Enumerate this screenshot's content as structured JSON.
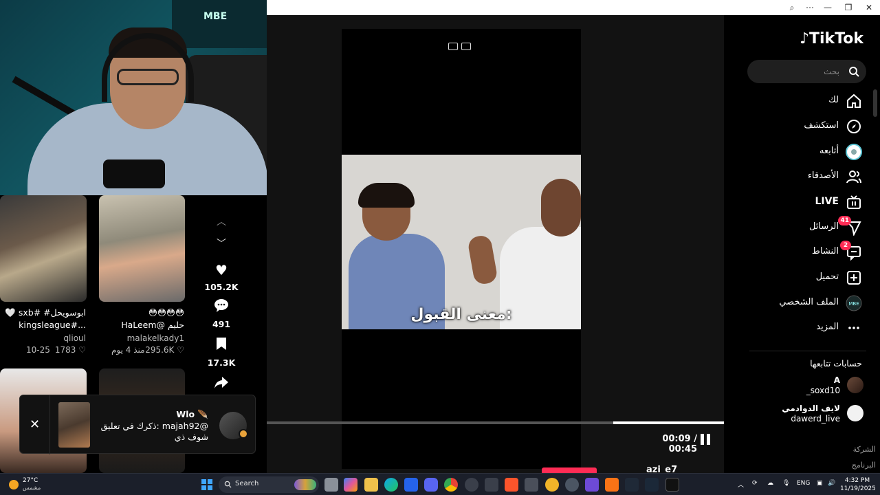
{
  "tiktok": {
    "brand": "TikTok",
    "search_placeholder": "بحث",
    "nav": [
      {
        "label": "لك",
        "icon": "home-icon"
      },
      {
        "label": "استكشف",
        "icon": "compass-icon"
      },
      {
        "label": "أتابعه",
        "icon": "following-avatar-icon"
      },
      {
        "label": "الأصدقاء",
        "icon": "friends-icon"
      },
      {
        "label": "LIVE",
        "icon": "live-tv-icon"
      },
      {
        "label": "الرسائل",
        "icon": "messages-icon",
        "badge": "41"
      },
      {
        "label": "النشاط",
        "icon": "activity-icon",
        "badge": "2"
      },
      {
        "label": "تحميل",
        "icon": "upload-plus-icon"
      },
      {
        "label": "الملف الشخصي",
        "icon": "profile-avatar-icon"
      },
      {
        "label": "المزيد",
        "icon": "more-dots-icon"
      }
    ],
    "following_title": "حسابات تتابعها",
    "following": [
      {
        "name": "A",
        "handle": "_soxd10"
      },
      {
        "name": "لايف الدوادمي",
        "handle": "dawerd_live"
      }
    ],
    "footer": [
      "الشركة",
      "البرنامج"
    ],
    "accent": "#fe2c55"
  },
  "video": {
    "caption": "معنى القبول:",
    "current_time": "00:09",
    "duration": "00:45",
    "time_display": "00:09 / 00:45",
    "progress": 0.2,
    "peek_author": "azi_e7"
  },
  "actions": {
    "likes": "105.2K",
    "comments": "491",
    "saves": "17.3K"
  },
  "grid": [
    {
      "title1": "🤍 sxb# #ابوسويحل",
      "title2": "kingsleague#...",
      "author": "qlioul",
      "date": "10-25",
      "likes": "1783 ♡"
    },
    {
      "title1": "😳😳😳😳",
      "title2": "HaLeem@ حليم",
      "author": "malakelkady1",
      "date": "منذ 4 يوم",
      "likes": "295.6K ♡"
    }
  ],
  "notification": {
    "user": "Wlo 🪶",
    "line1": "ذكرك في تعليق: majah92@",
    "line2": "شوف ذي"
  },
  "taskbar": {
    "weather_temp": "27°C",
    "weather_desc": "مشمس",
    "search_label": "Search",
    "lang": "ENG",
    "time": "4:32 PM",
    "date": "11/19/2025"
  },
  "webcam": {
    "logo": "MBE"
  }
}
